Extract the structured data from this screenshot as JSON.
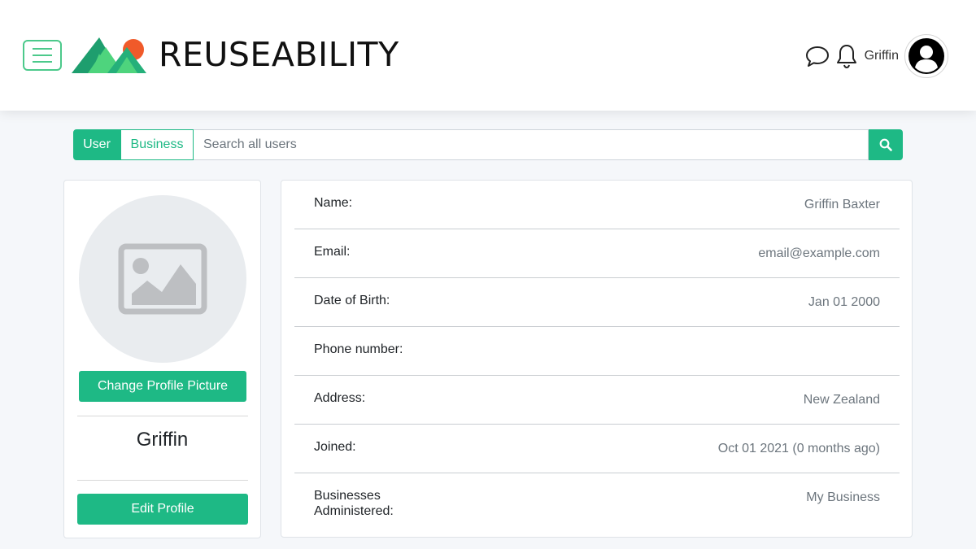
{
  "navbar": {
    "brand": "REUSEABILITY",
    "username": "Griffin",
    "icons": {
      "menu": "hamburger-menu-icon",
      "chat": "chat-icon",
      "notifications": "bell-icon",
      "avatar": "user-avatar-icon"
    },
    "colors": {
      "accent": "#4cc98b",
      "logo_dark": "#1e9e6e",
      "logo_light": "#4ed47d",
      "logo_sun": "#f05a2a"
    }
  },
  "search": {
    "tabs": [
      {
        "label": "User",
        "active": true
      },
      {
        "label": "Business",
        "active": false
      }
    ],
    "placeholder": "Search all users",
    "value": ""
  },
  "profile": {
    "change_picture_label": "Change Profile Picture",
    "name": "Griffin",
    "edit_label": "Edit Profile"
  },
  "details": [
    {
      "label": "Name:",
      "value": "Griffin Baxter"
    },
    {
      "label": "Email:",
      "value": "email@example.com"
    },
    {
      "label": "Date of Birth:",
      "value": "Jan 01 2000"
    },
    {
      "label": "Phone number:",
      "value": ""
    },
    {
      "label": "Address:",
      "value": "New Zealand"
    },
    {
      "label": "Joined:",
      "value": "Oct 01 2021 (0 months ago)"
    },
    {
      "label": "Businesses Administered:",
      "value": "My Business"
    }
  ],
  "theme": {
    "primary": "#1eb985",
    "muted_text": "#6c757d"
  }
}
